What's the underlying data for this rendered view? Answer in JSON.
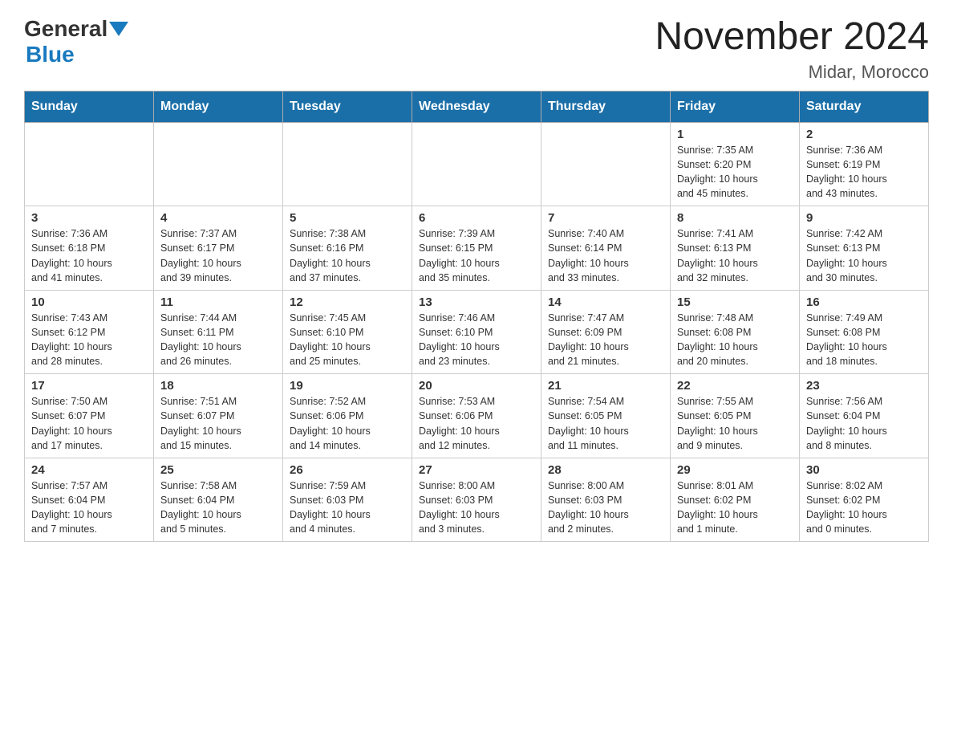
{
  "header": {
    "logo_general": "General",
    "logo_blue": "Blue",
    "month_year": "November 2024",
    "location": "Midar, Morocco"
  },
  "days_of_week": [
    "Sunday",
    "Monday",
    "Tuesday",
    "Wednesday",
    "Thursday",
    "Friday",
    "Saturday"
  ],
  "weeks": [
    [
      {
        "day": "",
        "info": ""
      },
      {
        "day": "",
        "info": ""
      },
      {
        "day": "",
        "info": ""
      },
      {
        "day": "",
        "info": ""
      },
      {
        "day": "",
        "info": ""
      },
      {
        "day": "1",
        "info": "Sunrise: 7:35 AM\nSunset: 6:20 PM\nDaylight: 10 hours\nand 45 minutes."
      },
      {
        "day": "2",
        "info": "Sunrise: 7:36 AM\nSunset: 6:19 PM\nDaylight: 10 hours\nand 43 minutes."
      }
    ],
    [
      {
        "day": "3",
        "info": "Sunrise: 7:36 AM\nSunset: 6:18 PM\nDaylight: 10 hours\nand 41 minutes."
      },
      {
        "day": "4",
        "info": "Sunrise: 7:37 AM\nSunset: 6:17 PM\nDaylight: 10 hours\nand 39 minutes."
      },
      {
        "day": "5",
        "info": "Sunrise: 7:38 AM\nSunset: 6:16 PM\nDaylight: 10 hours\nand 37 minutes."
      },
      {
        "day": "6",
        "info": "Sunrise: 7:39 AM\nSunset: 6:15 PM\nDaylight: 10 hours\nand 35 minutes."
      },
      {
        "day": "7",
        "info": "Sunrise: 7:40 AM\nSunset: 6:14 PM\nDaylight: 10 hours\nand 33 minutes."
      },
      {
        "day": "8",
        "info": "Sunrise: 7:41 AM\nSunset: 6:13 PM\nDaylight: 10 hours\nand 32 minutes."
      },
      {
        "day": "9",
        "info": "Sunrise: 7:42 AM\nSunset: 6:13 PM\nDaylight: 10 hours\nand 30 minutes."
      }
    ],
    [
      {
        "day": "10",
        "info": "Sunrise: 7:43 AM\nSunset: 6:12 PM\nDaylight: 10 hours\nand 28 minutes."
      },
      {
        "day": "11",
        "info": "Sunrise: 7:44 AM\nSunset: 6:11 PM\nDaylight: 10 hours\nand 26 minutes."
      },
      {
        "day": "12",
        "info": "Sunrise: 7:45 AM\nSunset: 6:10 PM\nDaylight: 10 hours\nand 25 minutes."
      },
      {
        "day": "13",
        "info": "Sunrise: 7:46 AM\nSunset: 6:10 PM\nDaylight: 10 hours\nand 23 minutes."
      },
      {
        "day": "14",
        "info": "Sunrise: 7:47 AM\nSunset: 6:09 PM\nDaylight: 10 hours\nand 21 minutes."
      },
      {
        "day": "15",
        "info": "Sunrise: 7:48 AM\nSunset: 6:08 PM\nDaylight: 10 hours\nand 20 minutes."
      },
      {
        "day": "16",
        "info": "Sunrise: 7:49 AM\nSunset: 6:08 PM\nDaylight: 10 hours\nand 18 minutes."
      }
    ],
    [
      {
        "day": "17",
        "info": "Sunrise: 7:50 AM\nSunset: 6:07 PM\nDaylight: 10 hours\nand 17 minutes."
      },
      {
        "day": "18",
        "info": "Sunrise: 7:51 AM\nSunset: 6:07 PM\nDaylight: 10 hours\nand 15 minutes."
      },
      {
        "day": "19",
        "info": "Sunrise: 7:52 AM\nSunset: 6:06 PM\nDaylight: 10 hours\nand 14 minutes."
      },
      {
        "day": "20",
        "info": "Sunrise: 7:53 AM\nSunset: 6:06 PM\nDaylight: 10 hours\nand 12 minutes."
      },
      {
        "day": "21",
        "info": "Sunrise: 7:54 AM\nSunset: 6:05 PM\nDaylight: 10 hours\nand 11 minutes."
      },
      {
        "day": "22",
        "info": "Sunrise: 7:55 AM\nSunset: 6:05 PM\nDaylight: 10 hours\nand 9 minutes."
      },
      {
        "day": "23",
        "info": "Sunrise: 7:56 AM\nSunset: 6:04 PM\nDaylight: 10 hours\nand 8 minutes."
      }
    ],
    [
      {
        "day": "24",
        "info": "Sunrise: 7:57 AM\nSunset: 6:04 PM\nDaylight: 10 hours\nand 7 minutes."
      },
      {
        "day": "25",
        "info": "Sunrise: 7:58 AM\nSunset: 6:04 PM\nDaylight: 10 hours\nand 5 minutes."
      },
      {
        "day": "26",
        "info": "Sunrise: 7:59 AM\nSunset: 6:03 PM\nDaylight: 10 hours\nand 4 minutes."
      },
      {
        "day": "27",
        "info": "Sunrise: 8:00 AM\nSunset: 6:03 PM\nDaylight: 10 hours\nand 3 minutes."
      },
      {
        "day": "28",
        "info": "Sunrise: 8:00 AM\nSunset: 6:03 PM\nDaylight: 10 hours\nand 2 minutes."
      },
      {
        "day": "29",
        "info": "Sunrise: 8:01 AM\nSunset: 6:02 PM\nDaylight: 10 hours\nand 1 minute."
      },
      {
        "day": "30",
        "info": "Sunrise: 8:02 AM\nSunset: 6:02 PM\nDaylight: 10 hours\nand 0 minutes."
      }
    ]
  ]
}
